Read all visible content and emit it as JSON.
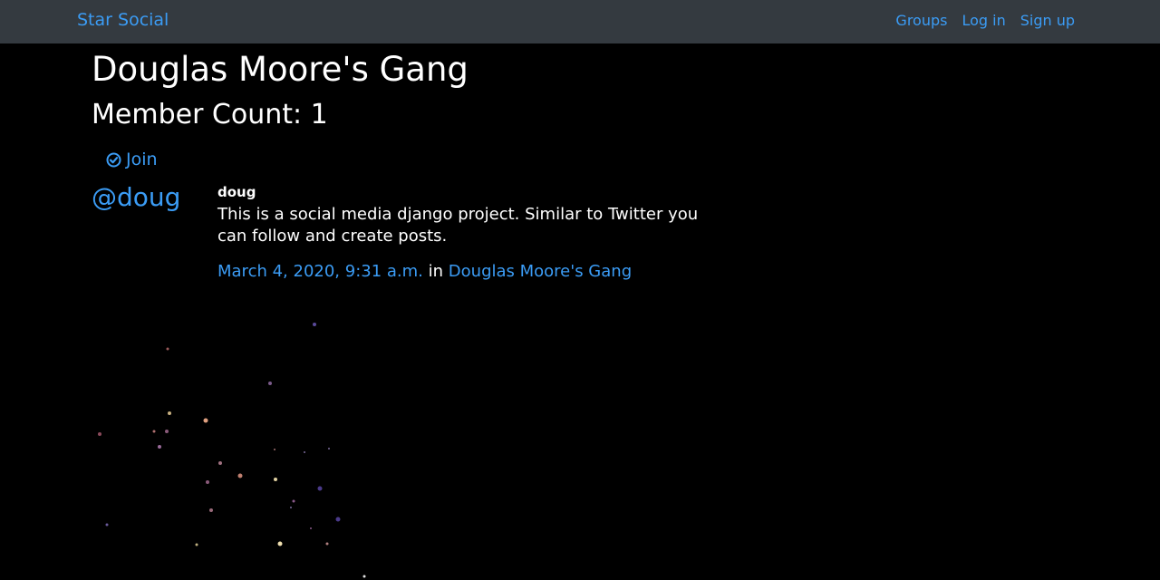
{
  "navbar": {
    "brand": "Star Social",
    "links": [
      "Groups",
      "Log in",
      "Sign up"
    ]
  },
  "group": {
    "title": "Douglas Moore's Gang",
    "member_count": "Member Count: 1",
    "join_label": "Join"
  },
  "post": {
    "handle": "@doug",
    "username": "doug",
    "text": "This is a social media django project. Similar to Twitter you can follow and create posts.",
    "timestamp": "March 4, 2020, 9:31 a.m.",
    "in_label": "in",
    "group_link": "Douglas Moore's Gang"
  },
  "colors": {
    "link": "#3b9cf5",
    "navbar_bg": "#343a40",
    "page_bg": "#000000"
  }
}
